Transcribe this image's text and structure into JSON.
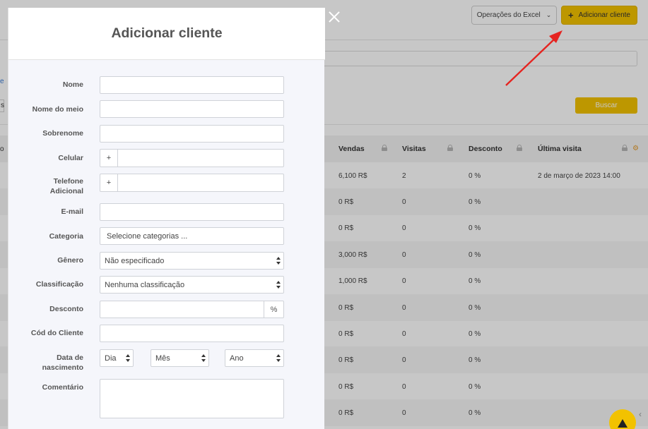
{
  "toolbar": {
    "excel_label": "Operações do Excel",
    "add_client_label": "Adicionar cliente",
    "search_label": "Buscar"
  },
  "bg_fragments": {
    "link": "e",
    "box": "s",
    "column": "o"
  },
  "table": {
    "headers": [
      "Vendas",
      "Visitas",
      "Desconto",
      "Última visita"
    ],
    "rows": [
      [
        "6,100 R$",
        "2",
        "0 %",
        "2 de março de 2023 14:00"
      ],
      [
        "0 R$",
        "0",
        "0 %",
        ""
      ],
      [
        "0 R$",
        "0",
        "0 %",
        ""
      ],
      [
        "3,000 R$",
        "0",
        "0 %",
        ""
      ],
      [
        "1,000 R$",
        "0",
        "0 %",
        ""
      ],
      [
        "0 R$",
        "0",
        "0 %",
        ""
      ],
      [
        "0 R$",
        "0",
        "0 %",
        ""
      ],
      [
        "0 R$",
        "0",
        "0 %",
        ""
      ],
      [
        "0 R$",
        "0",
        "0 %",
        ""
      ],
      [
        "0 R$",
        "0",
        "0 %",
        ""
      ]
    ]
  },
  "modal": {
    "title": "Adicionar cliente",
    "labels": {
      "first_name": "Nome",
      "middle_name": "Nome do meio",
      "last_name": "Sobrenome",
      "mobile": "Celular",
      "extra_phone_line1": "Telefone",
      "extra_phone_line2": "Adicional",
      "email": "E-mail",
      "category": "Categoria",
      "gender": "Gênero",
      "classification": "Classificação",
      "discount": "Desconto",
      "client_code": "Cód do Cliente",
      "birth_line1": "Data de",
      "birth_line2": "nascimento",
      "comment": "Comentário"
    },
    "phone_prefix": "+",
    "category_placeholder": "Selecione categorias ...",
    "gender_value": "Não especificado",
    "classification_value": "Nenhuma classificação",
    "percent_suffix": "%",
    "birth_day": "Dia",
    "birth_month": "Mês",
    "birth_year": "Ano"
  },
  "icons": {
    "close": "close-icon",
    "lock": "lock-icon",
    "gear": "gear-icon",
    "chevron": "chevron-down-icon",
    "plus": "plus-icon",
    "support": "support-chat-icon"
  },
  "colors": {
    "accent": "#f2c200",
    "annotation_arrow": "#e52420"
  }
}
